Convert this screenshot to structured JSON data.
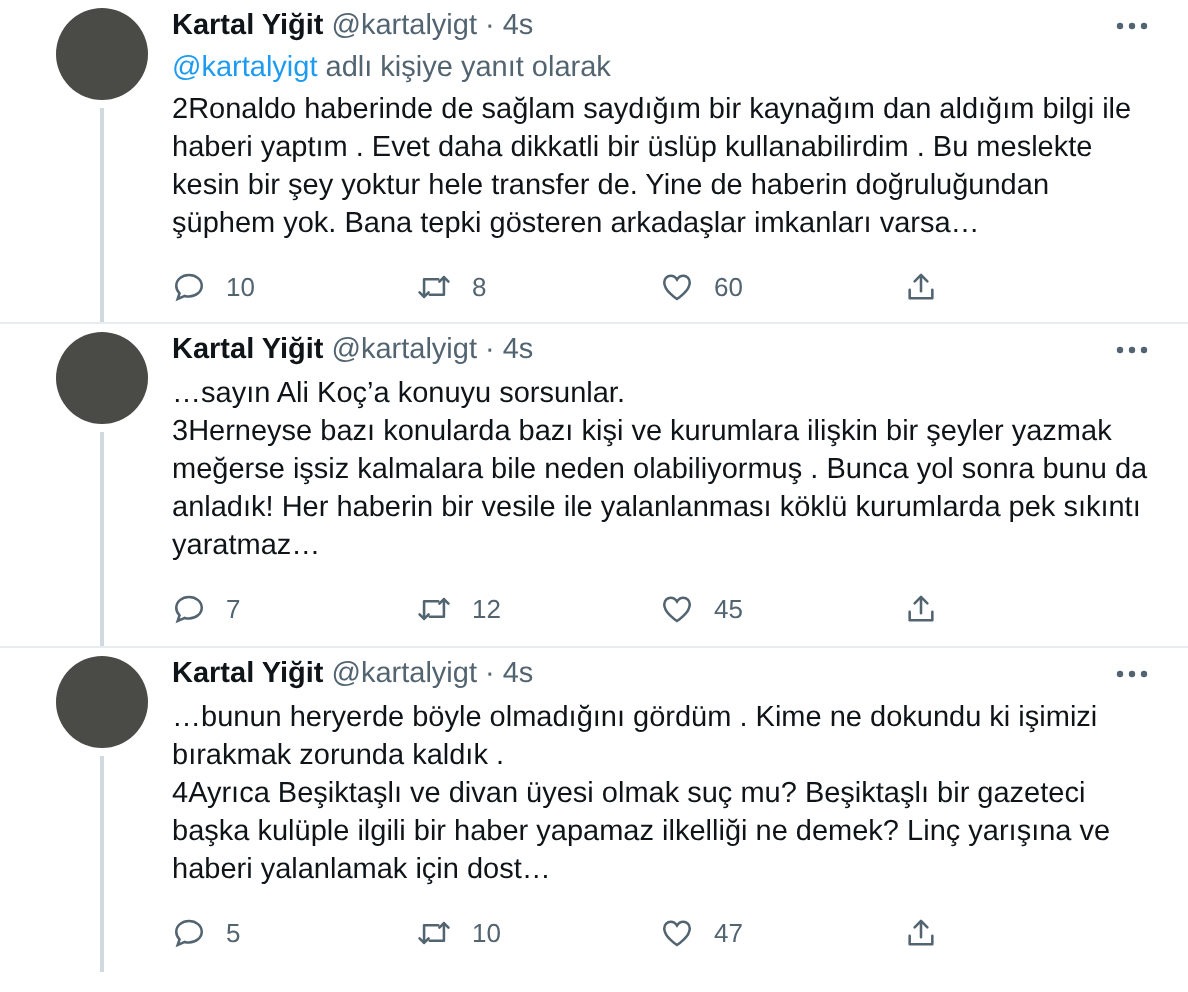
{
  "tweets": [
    {
      "author_name": "Kartal Yiğit",
      "handle": "@kartalyigt",
      "separator": "·",
      "time": "4s",
      "reply_to": {
        "mention": "@kartalyigt",
        "text": "adlı kişiye yanıt olarak"
      },
      "body_lines": [
        "2Ronaldo haberinde de sağlam saydığım bir kaynağım dan aldığım bilgi ile",
        "haberi yaptım . Evet daha dikkatli bir üslüp kullanabilirdim . Bu meslekte",
        "kesin bir şey yoktur hele transfer de. Yine de haberin doğruluğundan",
        "şüphem yok. Bana tepki gösteren arkadaşlar imkanları varsa…"
      ],
      "replies": "10",
      "retweets": "8",
      "likes": "60"
    },
    {
      "author_name": "Kartal Yiğit",
      "handle": "@kartalyigt",
      "separator": "·",
      "time": "4s",
      "body_lines": [
        "…sayın Ali Koç’a konuyu sorsunlar.",
        "3Herneyse bazı konularda bazı kişi ve kurumlara ilişkin bir şeyler yazmak",
        "meğerse işsiz kalmalara bile neden olabiliyormuş . Bunca yol sonra bunu da",
        "anladık! Her haberin bir vesile ile yalanlanması köklü kurumlarda pek sıkıntı",
        "yaratmaz…"
      ],
      "replies": "7",
      "retweets": "12",
      "likes": "45"
    },
    {
      "author_name": "Kartal Yiğit",
      "handle": "@kartalyigt",
      "separator": "·",
      "time": "4s",
      "body_lines": [
        "…bunun heryerde böyle olmadığını gördüm . Kime ne dokundu ki işimizi",
        "bırakmak zorunda kaldık .",
        "4Ayrıca Beşiktaşlı ve divan üyesi olmak suç mu? Beşiktaşlı bir gazeteci",
        "başka kulüple ilgili bir haber yapamaz ilkelliği ne demek? Linç yarışına ve",
        "haberi yalanlamak için dost…"
      ],
      "replies": "5",
      "retweets": "10",
      "likes": "47"
    }
  ]
}
